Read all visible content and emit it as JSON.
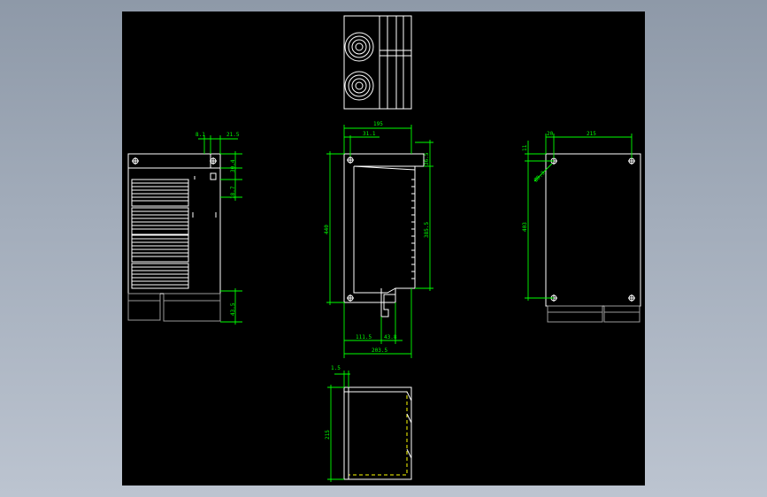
{
  "colors": {
    "background_outer": "#9aa5b3",
    "canvas": "#000000",
    "outline": "#ffffff",
    "dimension": "#00ff00",
    "hidden_line": "#ffff00"
  },
  "dimensions": {
    "left": {
      "d1": "8.1",
      "d2": "21.5",
      "d3": "30.4",
      "d4": "18.7",
      "d5": "43.5"
    },
    "front": {
      "width_top": "195",
      "offset_top": "31.1",
      "height": "440",
      "inner_height": "385.5",
      "small_right": "36.5",
      "bottom_left": "111.5",
      "bottom_right": "43.8",
      "bottom_total": "203.5"
    },
    "right": {
      "d_small": "11",
      "d_left": "20",
      "width": "215",
      "hole": "Ø8.3",
      "height": "403"
    },
    "bottom": {
      "small": "1.5",
      "height": "215"
    }
  }
}
